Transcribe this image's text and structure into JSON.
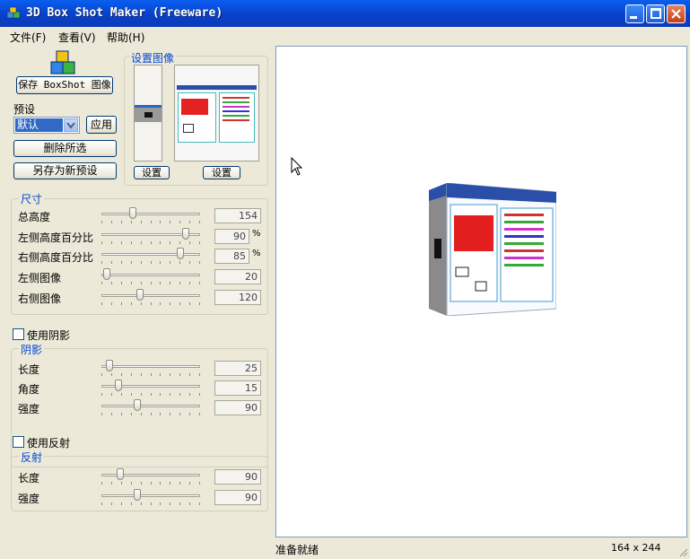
{
  "window": {
    "title": "3D Box Shot Maker (Freeware)"
  },
  "menu": {
    "file": "文件(F)",
    "view": "查看(V)",
    "help": "帮助(H)"
  },
  "left": {
    "save_button": "保存 BoxShot 图像",
    "preset_label": "预设",
    "preset_value": "默认",
    "apply_button": "应用",
    "delete_button": "删除所选",
    "save_preset_button": "另存为新预设",
    "image_group": {
      "title": "设置图像",
      "set_left": "设置",
      "set_right": "设置"
    }
  },
  "size": {
    "title": "尺寸",
    "rows": [
      {
        "label": "总高度",
        "value": "154",
        "unit": "",
        "slider": 0.3
      },
      {
        "label": "左侧高度百分比",
        "value": "90",
        "unit": "%",
        "slider": 0.88
      },
      {
        "label": "右侧高度百分比",
        "value": "85",
        "unit": "%",
        "slider": 0.82
      },
      {
        "label": "左侧图像",
        "value": "20",
        "unit": "",
        "slider": 0.02
      },
      {
        "label": "右侧图像",
        "value": "120",
        "unit": "",
        "slider": 0.38
      }
    ]
  },
  "shadow": {
    "checkbox_label": "使用阴影",
    "title": "阴影",
    "rows": [
      {
        "label": "长度",
        "value": "25",
        "slider": 0.05
      },
      {
        "label": "角度",
        "value": "15",
        "slider": 0.15
      },
      {
        "label": "强度",
        "value": "90",
        "slider": 0.35
      }
    ]
  },
  "reflection": {
    "checkbox_label": "使用反射",
    "title": "反射",
    "rows": [
      {
        "label": "长度",
        "value": "90",
        "slider": 0.17
      },
      {
        "label": "强度",
        "value": "90",
        "slider": 0.35
      }
    ]
  },
  "status": {
    "text": "准备就绪",
    "dimensions": "164 x 244"
  }
}
